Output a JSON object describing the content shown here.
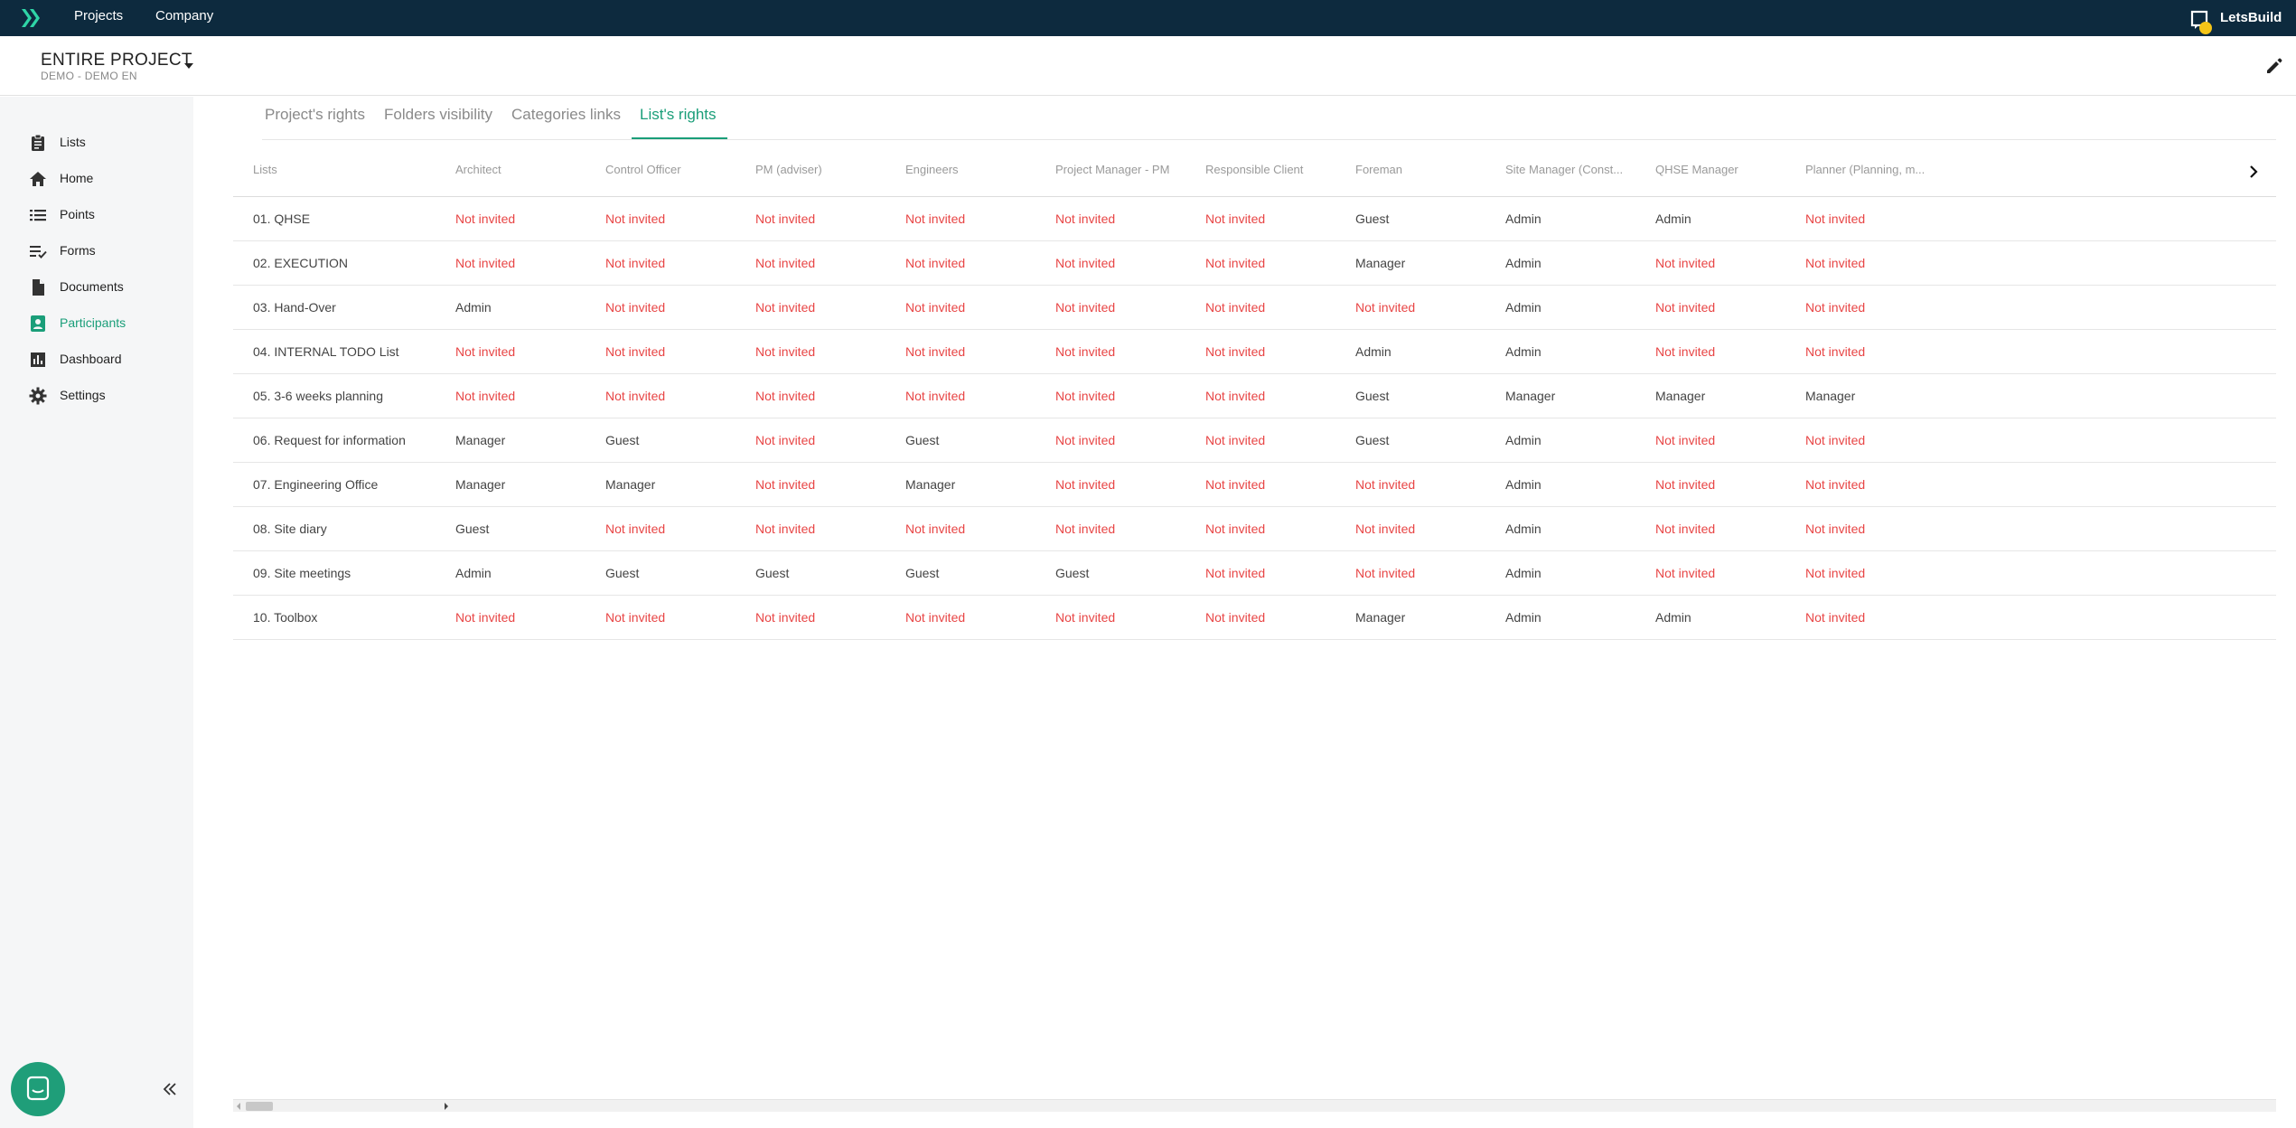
{
  "topbar": {
    "logo": "letsbuild-logo",
    "nav": [
      "Projects",
      "Company"
    ],
    "notification_icon": "notification-icon",
    "account_label": "LetsBuild"
  },
  "project": {
    "title": "ENTIRE PROJECT",
    "subtitle": "DEMO - DEMO EN"
  },
  "sidebar": {
    "items": [
      {
        "label": "Lists",
        "icon": "clipboard-icon",
        "active": false
      },
      {
        "label": "Home",
        "icon": "home-icon",
        "active": false
      },
      {
        "label": "Points",
        "icon": "list-icon",
        "active": false
      },
      {
        "label": "Forms",
        "icon": "form-icon",
        "active": false
      },
      {
        "label": "Documents",
        "icon": "document-icon",
        "active": false
      },
      {
        "label": "Participants",
        "icon": "participants-icon",
        "active": true
      },
      {
        "label": "Dashboard",
        "icon": "bar-chart-icon",
        "active": false
      },
      {
        "label": "Settings",
        "icon": "gear-icon",
        "active": false
      }
    ]
  },
  "tabs": [
    {
      "label": "Project's rights",
      "active": false
    },
    {
      "label": "Folders visibility",
      "active": false
    },
    {
      "label": "Categories links",
      "active": false
    },
    {
      "label": "List's rights",
      "active": true
    }
  ],
  "table": {
    "headers": [
      "Lists",
      "Architect",
      "Control Officer",
      "PM (adviser)",
      "Engineers",
      "Project Manager - PM",
      "Responsible Client",
      "Foreman",
      "Site Manager (Const...",
      "QHSE Manager",
      "Planner (Planning, m..."
    ],
    "rows": [
      [
        "01. QHSE",
        "Not invited",
        "Not invited",
        "Not invited",
        "Not invited",
        "Not invited",
        "Not invited",
        "Guest",
        "Admin",
        "Admin",
        "Not invited"
      ],
      [
        "02. EXECUTION",
        "Not invited",
        "Not invited",
        "Not invited",
        "Not invited",
        "Not invited",
        "Not invited",
        "Manager",
        "Admin",
        "Not invited",
        "Not invited"
      ],
      [
        "03. Hand-Over",
        "Admin",
        "Not invited",
        "Not invited",
        "Not invited",
        "Not invited",
        "Not invited",
        "Not invited",
        "Admin",
        "Not invited",
        "Not invited"
      ],
      [
        "04. INTERNAL TODO List",
        "Not invited",
        "Not invited",
        "Not invited",
        "Not invited",
        "Not invited",
        "Not invited",
        "Admin",
        "Admin",
        "Not invited",
        "Not invited"
      ],
      [
        "05. 3-6 weeks planning",
        "Not invited",
        "Not invited",
        "Not invited",
        "Not invited",
        "Not invited",
        "Not invited",
        "Guest",
        "Manager",
        "Manager",
        "Manager"
      ],
      [
        "06. Request for information",
        "Manager",
        "Guest",
        "Not invited",
        "Guest",
        "Not invited",
        "Not invited",
        "Guest",
        "Admin",
        "Not invited",
        "Not invited"
      ],
      [
        "07. Engineering Office",
        "Manager",
        "Manager",
        "Not invited",
        "Manager",
        "Not invited",
        "Not invited",
        "Not invited",
        "Admin",
        "Not invited",
        "Not invited"
      ],
      [
        "08. Site diary",
        "Guest",
        "Not invited",
        "Not invited",
        "Not invited",
        "Not invited",
        "Not invited",
        "Not invited",
        "Admin",
        "Not invited",
        "Not invited"
      ],
      [
        "09. Site meetings",
        "Admin",
        "Guest",
        "Guest",
        "Guest",
        "Guest",
        "Not invited",
        "Not invited",
        "Admin",
        "Not invited",
        "Not invited"
      ],
      [
        "10. Toolbox",
        "Not invited",
        "Not invited",
        "Not invited",
        "Not invited",
        "Not invited",
        "Not invited",
        "Manager",
        "Admin",
        "Admin",
        "Not invited"
      ]
    ]
  },
  "colors": {
    "topbar": "#0d2a3e",
    "accent": "#1a9e79",
    "not_invited": "#e84545",
    "sidebar_bg": "#f5f6f7"
  },
  "icons": {
    "edit": "pencil-icon",
    "scroll_right": "chevron-right-icon",
    "chat": "chat-icon",
    "collapse": "double-chevron-left-icon"
  }
}
